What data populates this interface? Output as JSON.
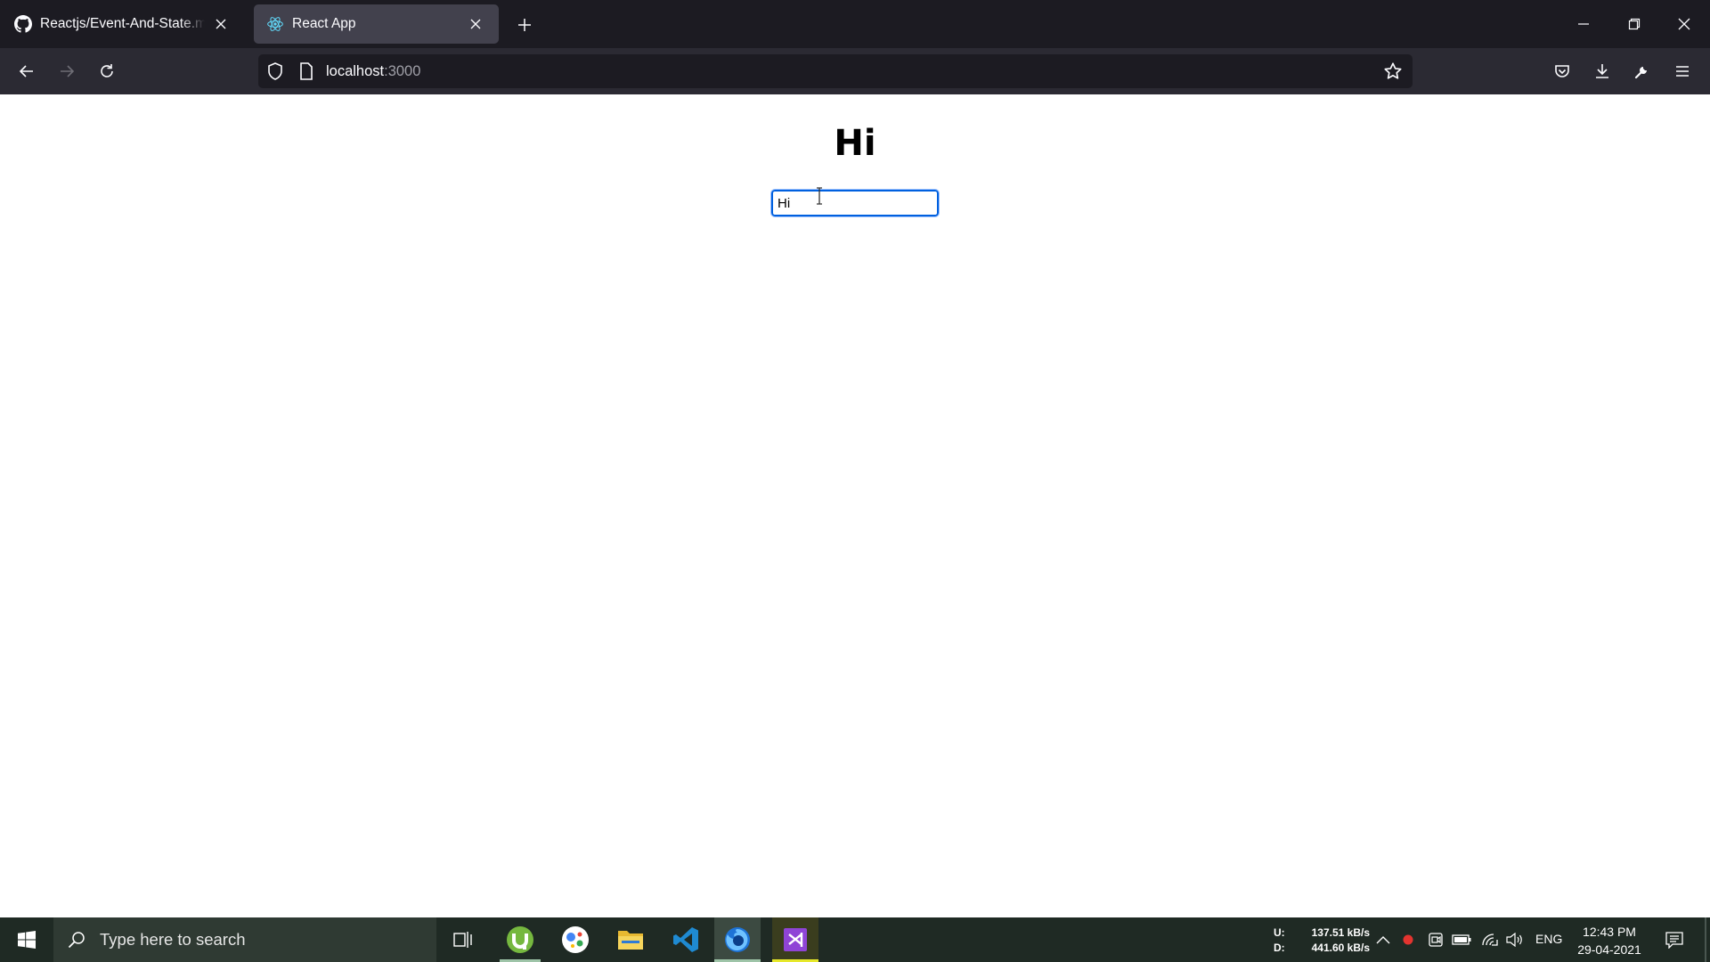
{
  "browser": {
    "tabs": [
      {
        "title": "Reactjs/Event-And-State.md at",
        "icon": "github-icon",
        "active": false
      },
      {
        "title": "React App",
        "icon": "react-icon",
        "active": true
      }
    ],
    "url_host": "localhost",
    "url_port": ":3000"
  },
  "page": {
    "heading": "Hi",
    "input_value": "Hi"
  },
  "taskbar": {
    "search_placeholder": "Type here to search",
    "apps": [
      "task-view-icon",
      "utorrent-icon",
      "google-assistant-icon",
      "file-explorer-icon",
      "vscode-icon",
      "firefox-icon",
      "visual-studio-icon"
    ],
    "net_upload_label": "U:",
    "net_download_label": "D:",
    "net_upload": "137.51 kB/s",
    "net_download": "441.60 kB/s",
    "language": "ENG",
    "time": "12:43 PM",
    "date": "29-04-2021"
  },
  "colors": {
    "tabbar_bg": "#1c1b22",
    "toolbar_bg": "#2b2a33",
    "active_tab_bg": "#42414d",
    "focus_ring": "#0060df",
    "taskbar_bg": "#1f2a24"
  }
}
